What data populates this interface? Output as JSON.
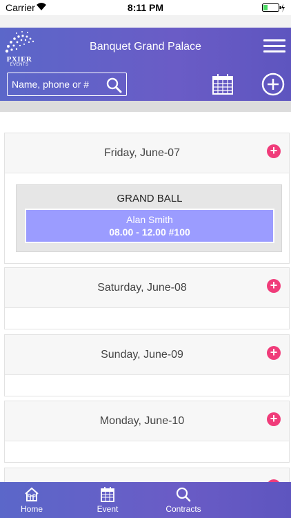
{
  "status_bar": {
    "carrier": "Carrier",
    "time": "8:11 PM"
  },
  "header": {
    "logo_brand": "PXIER",
    "logo_sub": "EVENTS",
    "title": "Banquet Grand Palace",
    "search_placeholder": "Name, phone or #"
  },
  "days": [
    {
      "label": "Friday, June-07",
      "events": [
        {
          "name": "GRAND BALL",
          "person": "Alan Smith",
          "time": "08.00 - 12.00 #100"
        }
      ]
    },
    {
      "label": "Saturday, June-08",
      "events": []
    },
    {
      "label": "Sunday, June-09",
      "events": []
    },
    {
      "label": "Monday, June-10",
      "events": []
    }
  ],
  "bottom_nav": [
    {
      "label": "Home",
      "icon": "home-icon"
    },
    {
      "label": "Event",
      "icon": "calendar-icon"
    },
    {
      "label": "Contracts",
      "icon": "search-icon"
    }
  ],
  "colors": {
    "header": "#6a5cc6",
    "accent_plus": "#f03c7a",
    "event_card": "#9b9cff"
  }
}
